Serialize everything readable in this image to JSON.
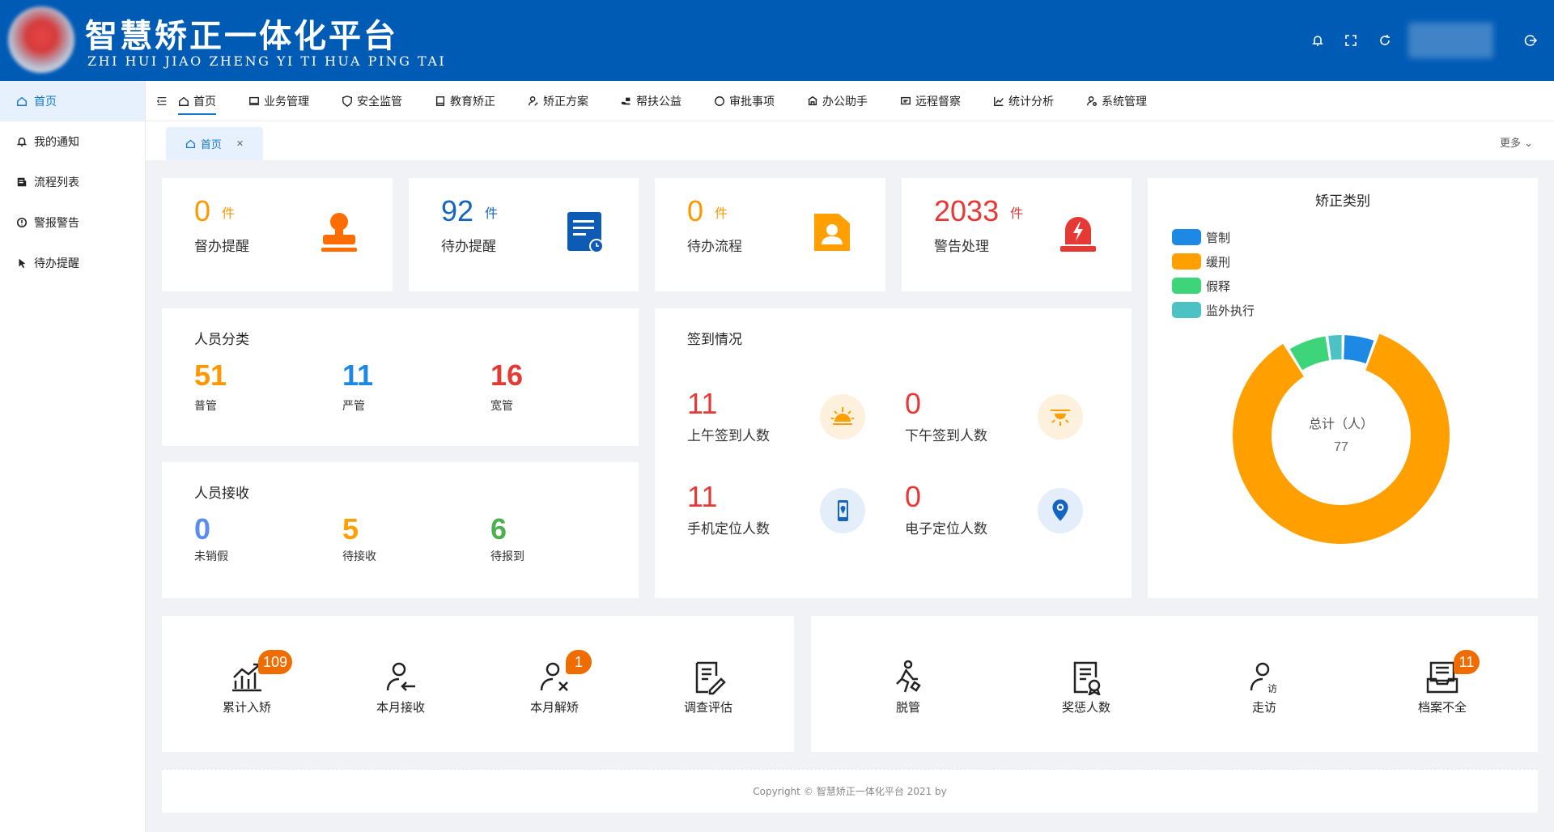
{
  "header": {
    "title": "智慧矫正一体化平台",
    "subtitle": "ZHI HUI JIAO ZHENG YI TI HUA PING TAI"
  },
  "sidebar": {
    "items": [
      {
        "label": "首页",
        "icon": "home-icon"
      },
      {
        "label": "我的通知",
        "icon": "bell-icon"
      },
      {
        "label": "流程列表",
        "icon": "list-icon"
      },
      {
        "label": "警报警告",
        "icon": "alert-icon"
      },
      {
        "label": "待办提醒",
        "icon": "pointer-icon"
      }
    ]
  },
  "nav": {
    "items": [
      "首页",
      "业务管理",
      "安全监管",
      "教育矫正",
      "矫正方案",
      "帮扶公益",
      "审批事项",
      "办公助手",
      "远程督察",
      "统计分析",
      "系统管理"
    ]
  },
  "tabs": {
    "active": "首页",
    "more": "更多"
  },
  "stats": [
    {
      "value": "0",
      "unit": "件",
      "label": "督办提醒",
      "color": "#ff9800"
    },
    {
      "value": "92",
      "unit": "件",
      "label": "待办提醒",
      "color": "#1565c0"
    },
    {
      "value": "0",
      "unit": "件",
      "label": "待办流程",
      "color": "#ff9800"
    },
    {
      "value": "2033",
      "unit": "件",
      "label": "警告处理",
      "color": "#e53935"
    }
  ],
  "personnel_class": {
    "title": "人员分类",
    "items": [
      {
        "value": "51",
        "label": "普管"
      },
      {
        "value": "11",
        "label": "严管"
      },
      {
        "value": "16",
        "label": "宽管"
      }
    ]
  },
  "personnel_receive": {
    "title": "人员接收",
    "items": [
      {
        "value": "0",
        "label": "未销假"
      },
      {
        "value": "5",
        "label": "待接收"
      },
      {
        "value": "6",
        "label": "待报到"
      }
    ]
  },
  "signin": {
    "title": "签到情况",
    "items": [
      {
        "value": "11",
        "label": "上午签到人数"
      },
      {
        "value": "0",
        "label": "下午签到人数"
      },
      {
        "value": "11",
        "label": "手机定位人数"
      },
      {
        "value": "0",
        "label": "电子定位人数"
      }
    ]
  },
  "chart_data": {
    "type": "pie",
    "title": "矫正类别",
    "center_label": "总计（人）",
    "center_value": "77",
    "categories": [
      "管制",
      "缓刑",
      "假释",
      "监外执行"
    ],
    "values": [
      4,
      66,
      5,
      2
    ],
    "colors": [
      "#1e88e5",
      "#ffa000",
      "#3ed47a",
      "#4cc2c4"
    ]
  },
  "quick_left": [
    {
      "label": "累计入矫",
      "badge": "109"
    },
    {
      "label": "本月接收",
      "badge": ""
    },
    {
      "label": "本月解矫",
      "badge": "1"
    },
    {
      "label": "调查评估",
      "badge": ""
    }
  ],
  "quick_right": [
    {
      "label": "脱管",
      "badge": ""
    },
    {
      "label": "奖惩人数",
      "badge": ""
    },
    {
      "label": "走访",
      "badge": ""
    },
    {
      "label": "档案不全",
      "badge": "11"
    }
  ],
  "footer": {
    "text": "Copyright",
    "brand": "智慧矫正一体化平台 2021 by"
  }
}
